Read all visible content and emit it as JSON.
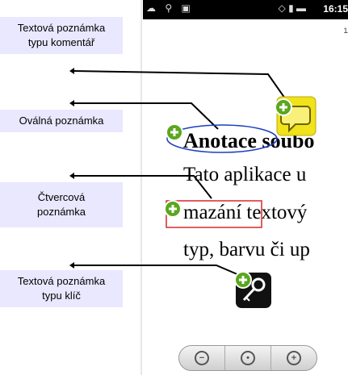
{
  "labels": {
    "comment_note": "Textová poznámka\ntypu komentář",
    "oval_note": "Oválná poznámka",
    "square_note": "Čtvercová\npoznámka",
    "key_note": "Textová poznámka\ntypu klíč"
  },
  "status_bar": {
    "time": "16:15",
    "left_icons": [
      "cloud-icon",
      "usb-icon",
      "android-icon"
    ],
    "right_icons": [
      "vibrate-icon",
      "signal-icon",
      "battery-icon"
    ]
  },
  "document": {
    "page_indicator": "1/",
    "title": "Anotace soubo",
    "lines": [
      "Tato aplikace u",
      "mazání textový",
      "typ, barvu či up"
    ]
  },
  "zoom": {
    "out_icon": "zoom-out-icon",
    "fit_icon": "zoom-fit-icon",
    "in_icon": "zoom-in-icon"
  },
  "colors": {
    "label_bg": "#e9e8ff",
    "oval_stroke": "#1a3fbf",
    "square_stroke": "#d42a2a",
    "comment_icon": "#f0e21b",
    "add_badge": "#5aa71e"
  }
}
